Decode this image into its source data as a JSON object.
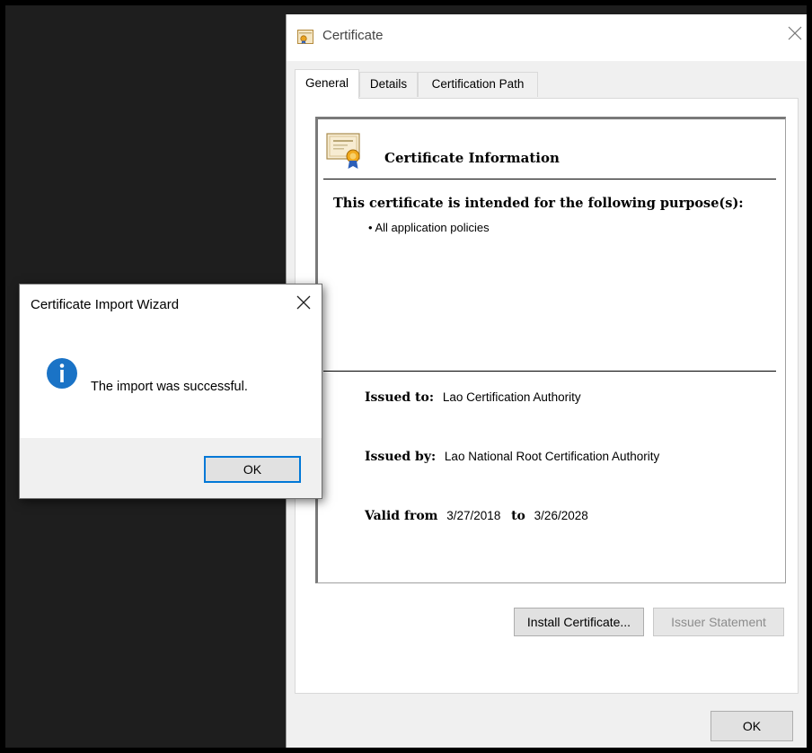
{
  "certificate_window": {
    "title": "Certificate",
    "tabs": [
      {
        "label": "General",
        "active": true
      },
      {
        "label": "Details",
        "active": false
      },
      {
        "label": "Certification Path",
        "active": false
      }
    ],
    "info_heading": "Certificate Information",
    "purpose_heading": "This certificate is intended for the following purpose(s):",
    "purposes": [
      "• All application policies"
    ],
    "issued_to_label": "Issued to:",
    "issued_to_value": "Lao Certification Authority",
    "issued_by_label": "Issued by:",
    "issued_by_value": "Lao National Root Certification Authority",
    "valid_from_label": "Valid from",
    "valid_from_value": "3/27/2018",
    "valid_to_label": "to",
    "valid_to_value": "3/26/2028",
    "install_button": "Install Certificate...",
    "issuer_statement_button": "Issuer Statement",
    "ok_button": "OK"
  },
  "import_wizard": {
    "title": "Certificate Import Wizard",
    "message": "The import was successful.",
    "ok_button": "OK"
  },
  "colors": {
    "info_blue": "#1a73c6",
    "focus_blue": "#0078d7"
  }
}
